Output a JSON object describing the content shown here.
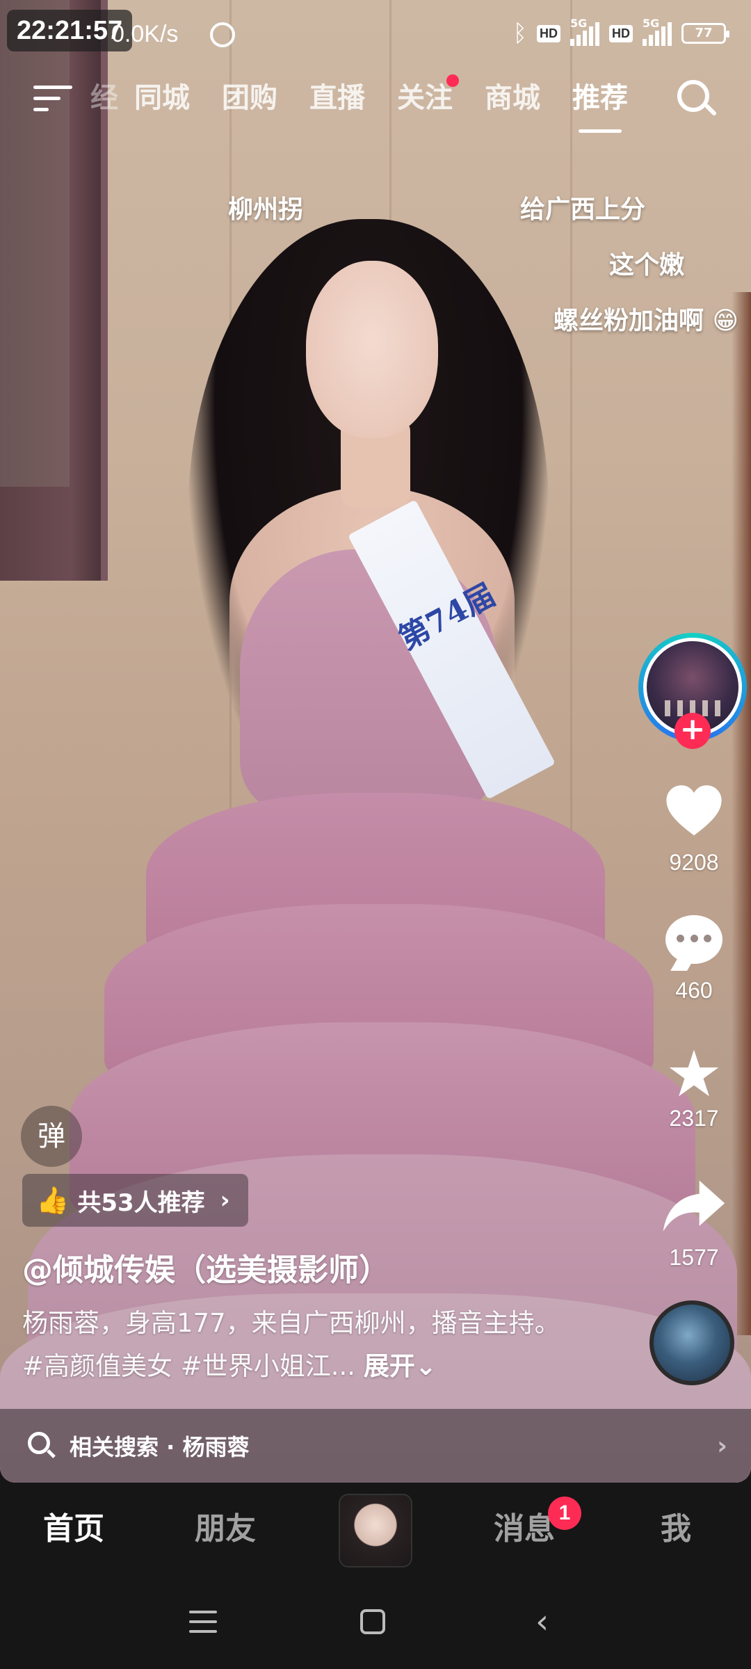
{
  "status_bar": {
    "time": "22:21:57",
    "net_speed": "0.0K/s",
    "hd_label": "HD",
    "net_type": "5G",
    "battery": "77"
  },
  "top_nav": {
    "partial_tab": "经",
    "tabs": [
      "同城",
      "团购",
      "直播",
      "关注",
      "商城",
      "推荐"
    ],
    "active_tab": "推荐"
  },
  "danmaku": [
    "柳州拐",
    "给广西上分",
    "这个嫩",
    "螺丝粉加油啊 😁"
  ],
  "video": {
    "sash_text": "第74届"
  },
  "right_rail": {
    "likes": "9208",
    "comments": "460",
    "favorites": "2317",
    "shares": "1577"
  },
  "info": {
    "danmaku_toggle": "弹",
    "recommend_chip": "共53人推荐",
    "author": "@倾城传娱（选美摄影师）",
    "description": "杨雨蓉，身高177，来自广西柳州，播音主持。 #高颜值美女 #世界小姐江...",
    "expand": "展开",
    "related_search": "相关搜索 · 杨雨蓉"
  },
  "bottom_tabs": {
    "home": "首页",
    "friends": "朋友",
    "messages": "消息",
    "messages_badge": "1",
    "me": "我"
  },
  "colors": {
    "accent_red": "#fe2c55",
    "ring_teal": "#14d0c4",
    "ring_blue": "#2a6cf1"
  },
  "icons": [
    "menu-icon",
    "search-icon",
    "heart-icon",
    "comment-icon",
    "star-icon",
    "share-icon",
    "thumb-up-icon",
    "chevron-right-icon",
    "bluetooth-icon",
    "alarm-icon"
  ]
}
